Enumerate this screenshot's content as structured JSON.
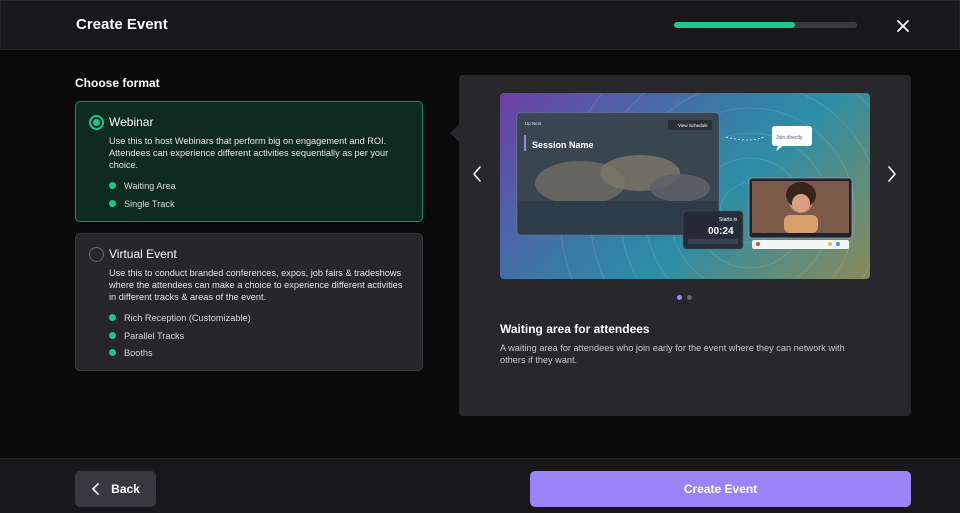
{
  "header": {
    "title": "Create Event",
    "progress_fraction": 0.66
  },
  "format": {
    "label": "Choose format",
    "options": [
      {
        "title": "Webinar",
        "description": "Use this to host Webinars that perform big on engagement and ROI. Attendees can experience different activities sequentially as per your choice.",
        "features": [
          "Waiting Area",
          "Single Track"
        ],
        "selected": true
      },
      {
        "title": "Virtual Event",
        "description": "Use this to conduct branded conferences, expos, job fairs & tradeshows where the attendees can make a choice to experience different activities in different tracks & areas of the event.",
        "features": [
          "Rich Reception (Customizable)",
          "Parallel Tracks",
          "Booths"
        ],
        "selected": false
      }
    ]
  },
  "preview": {
    "image": {
      "top_label": "Up Next",
      "view_schedule": "View Schedule",
      "session_name": "Session Name",
      "join_directly": "Join directly",
      "starts_in": "Starts in",
      "countdown": "00:24"
    },
    "slide_count": 2,
    "active_slide": 0,
    "title": "Waiting area for attendees",
    "description": "A waiting area for attendees who join early for the event where they can network with others if they want."
  },
  "footer": {
    "back_label": "Back",
    "create_label": "Create Event"
  },
  "colors": {
    "accent_green": "#1cc88a",
    "accent_purple": "#9a83f7"
  }
}
